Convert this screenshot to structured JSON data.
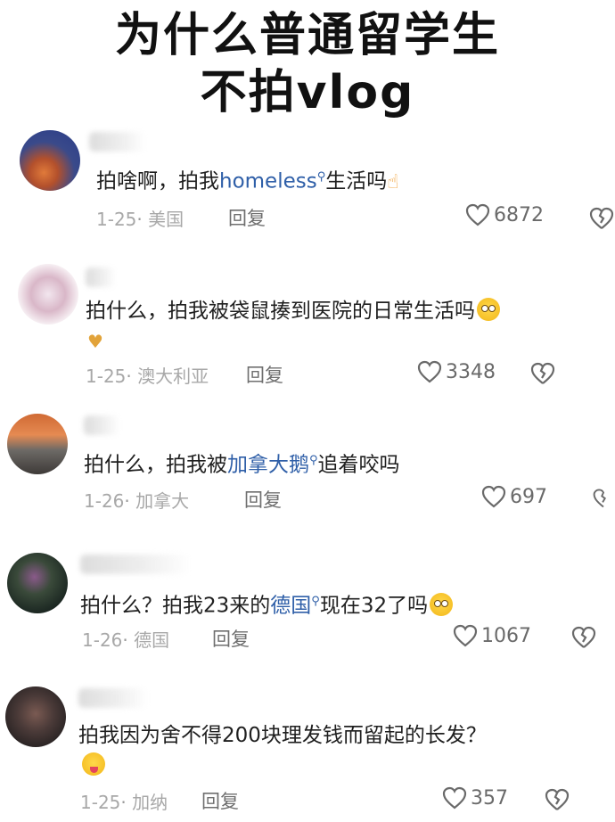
{
  "title": {
    "line1": "为什么普通留学生",
    "line2": "不拍vlog"
  },
  "comments": [
    {
      "text_before": "拍啥啊，拍我",
      "link": "homeless",
      "text_after": "生活吗",
      "emoji": "pointing-hand",
      "date": "1-25",
      "location": "美国",
      "reply": "回复",
      "likes": "6872"
    },
    {
      "text_before": "拍什么，拍我被袋鼠揍到医院的日常生活吗",
      "emoji": "flushed-face",
      "emoji2": "finger-heart",
      "date": "1-25",
      "location": "澳大利亚",
      "reply": "回复",
      "likes": "3348"
    },
    {
      "text_before": "拍什么，拍我被",
      "link": "加拿大鹅",
      "text_after": "追着咬吗",
      "date": "1-26",
      "location": "加拿大",
      "reply": "回复",
      "likes": "697"
    },
    {
      "text_before": "拍什么？拍我23来的",
      "link": "德国",
      "text_after": "现在32了吗",
      "emoji": "flushed-face",
      "date": "1-26",
      "location": "德国",
      "reply": "回复",
      "likes": "1067"
    },
    {
      "text_before": "拍我因为舍不得200块理发钱而留起的长发？",
      "emoji": "winking-tongue-face",
      "date": "1-25",
      "location": "加纳",
      "reply": "回复",
      "likes": "357"
    }
  ]
}
